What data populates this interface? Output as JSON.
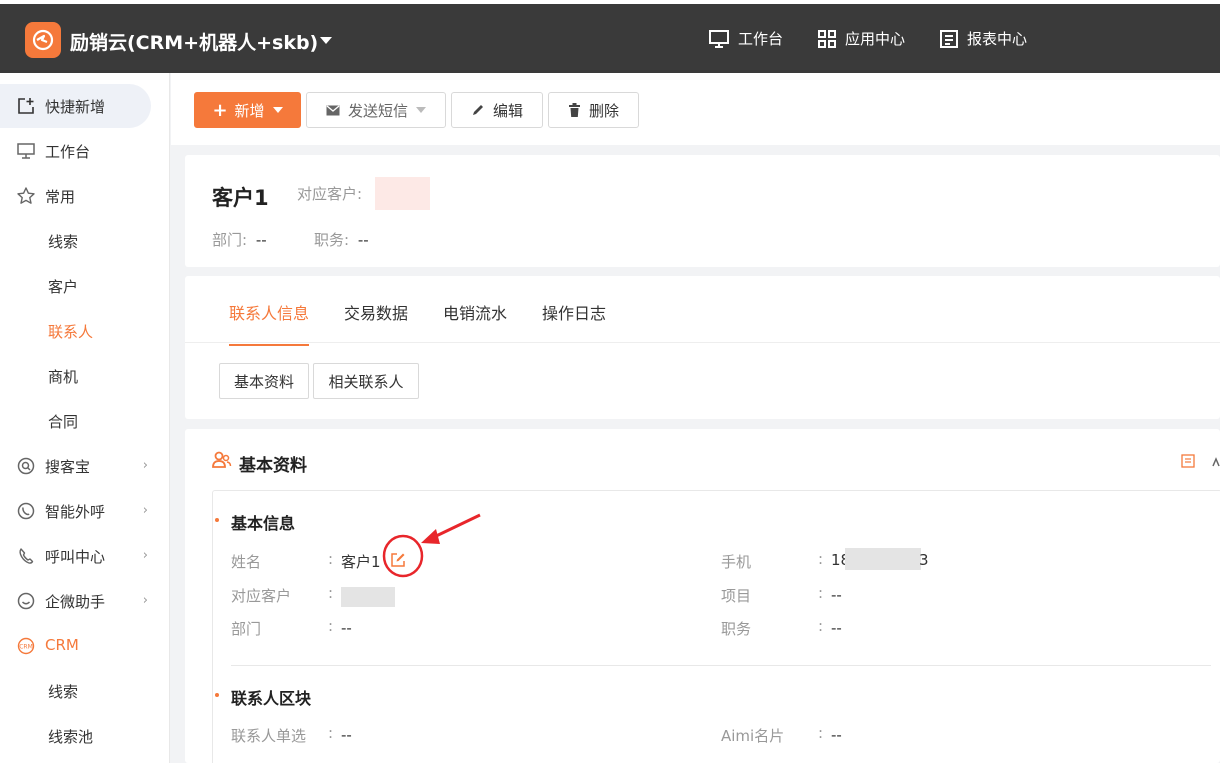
{
  "header": {
    "app_title": "励销云(CRM+机器人+skb)",
    "nav": [
      {
        "label": "工作台",
        "icon": "monitor-icon"
      },
      {
        "label": "应用中心",
        "icon": "grid-icon"
      },
      {
        "label": "报表中心",
        "icon": "report-icon"
      }
    ]
  },
  "sidebar": {
    "quick_add": "快捷新增",
    "workbench": "工作台",
    "common": "常用",
    "common_items": [
      "线索",
      "客户",
      "联系人",
      "商机",
      "合同"
    ],
    "soukebao": "搜客宝",
    "smart_call": "智能外呼",
    "call_center": "呼叫中心",
    "wecom": "企微助手",
    "crm": "CRM",
    "crm_items": [
      "线索",
      "线索池"
    ]
  },
  "toolbar": {
    "add": "新增",
    "send_sms": "发送短信",
    "edit": "编辑",
    "delete": "删除"
  },
  "summary": {
    "name": "客户1",
    "customer_label": "对应客户:",
    "dept_label": "部门:",
    "dept_value": "--",
    "position_label": "职务:",
    "position_value": "--"
  },
  "tabs": [
    "联系人信息",
    "交易数据",
    "电销流水",
    "操作日志"
  ],
  "subtabs": [
    "基本资料",
    "相关联系人"
  ],
  "basic": {
    "title": "基本资料",
    "group1_title": "基本信息",
    "group2_title": "联系人区块",
    "fields": {
      "name_label": "姓名",
      "name_value": "客户1",
      "phone_label": "手机",
      "phone_prefix": "18",
      "phone_suffix": "3",
      "customer_label": "对应客户",
      "project_label": "项目",
      "project_value": "--",
      "dept_label": "部门",
      "dept_value": "--",
      "position_label": "职务",
      "position_value": "--",
      "single_label": "联系人单选",
      "single_value": "--",
      "aimi_label": "Aimi名片",
      "aimi_value": "--"
    },
    "colon": ":"
  },
  "colors": {
    "accent": "#f5793b",
    "topbar": "#3a3a3a",
    "annotation": "#e8262b"
  }
}
